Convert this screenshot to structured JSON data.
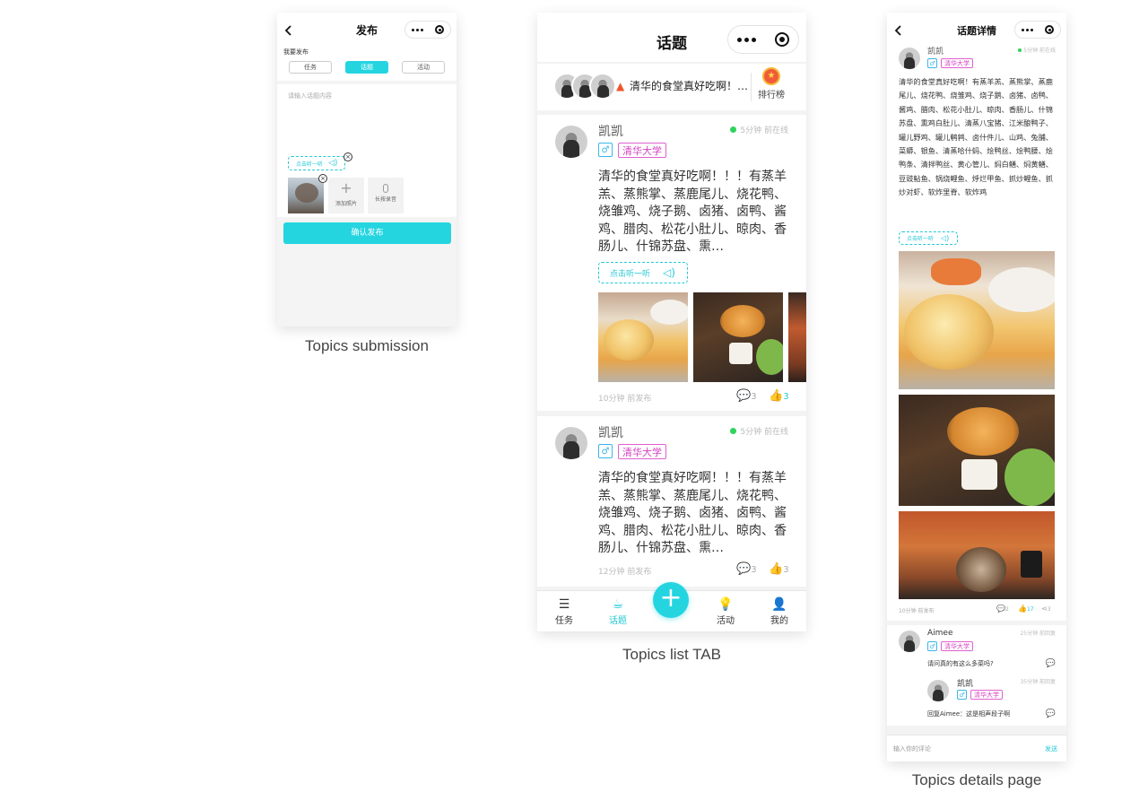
{
  "captions": {
    "submission": "Topics submission",
    "list": "Topics list TAB",
    "details": "Topics details page"
  },
  "submission": {
    "title": "发布",
    "want_label": "我要发布",
    "types": [
      "任务",
      "话题",
      "活动"
    ],
    "active_type": "话题",
    "placeholder": "请输入话题内容",
    "audio_label": "点击听一听",
    "add_photo_label": "添加照片",
    "record_label": "长按录音",
    "submit_label": "确认发布"
  },
  "list": {
    "title": "话题",
    "banner_text": "清华的食堂真好吃啊！…",
    "rank_label": "排行榜",
    "posts": [
      {
        "name": "凯凯",
        "online": "5分钟 前在线",
        "school": "清华大学",
        "gender": "♂",
        "content": "清华的食堂真好吃啊！！！有蒸羊羔、蒸熊掌、蒸鹿尾儿、烧花鸭、烧雏鸡、烧子鹅、卤猪、卤鸭、酱鸡、腊肉、松花小肚儿、晾肉、香肠儿、什锦苏盘、熏…",
        "audio": "点击听一听",
        "time": "10分钟 前发布",
        "comments": "3",
        "likes": "3"
      },
      {
        "name": "凯凯",
        "online": "5分钟 前在线",
        "school": "清华大学",
        "gender": "♂",
        "content": "清华的食堂真好吃啊！！！有蒸羊羔、蒸熊掌、蒸鹿尾儿、烧花鸭、烧雏鸡、烧子鹅、卤猪、卤鸭、酱鸡、腊肉、松花小肚儿、晾肉、香肠儿、什锦苏盘、熏…",
        "time": "12分钟 前发布",
        "comments": "3",
        "likes": "3"
      }
    ],
    "tabs": [
      "任务",
      "话题",
      "活动",
      "我的"
    ],
    "active_tab": "话题"
  },
  "details": {
    "title": "话题详情",
    "author": "凯凯",
    "online": "5分钟 前在线",
    "school": "清华大学",
    "gender": "♂",
    "content": "清华的食堂真好吃啊！有蒸羊羔、蒸熊掌、蒸鹿尾儿、烧花鸭、烧雏鸡、烧子鹅、卤猪、卤鸭、酱鸡、腊肉、松花小肚儿、晾肉、香肠儿、什锦苏盘、熏鸡白肚儿、清蒸八宝猪、江米酿鸭子、罐儿野鸡、罐儿鹌鹑、卤什件儿、山鸡、兔脯、菜蟒、银鱼、清蒸哈什蚂、烩鸭丝、烩鸭腰、烩鸭条、清拌鸭丝、黄心管儿、焖白鳝、焖黄鳝、豆豉鲇鱼、锅烧鲤鱼、烀烂甲鱼、抓炒鲤鱼、抓炒对虾、软炸里脊、软炸鸡",
    "audio": "点击听一听",
    "time": "10分钟 前发布",
    "comments": "2",
    "likes": "17",
    "shares": "3",
    "replies": [
      {
        "name": "Aimee",
        "school": "清华大学",
        "gender": "♂",
        "time": "25分钟 前回复",
        "text": "请问真的有这么多菜吗?"
      },
      {
        "name": "凯凯",
        "school": "清华大学",
        "gender": "♂",
        "time": "35分钟 前回复",
        "text": "回复Aimee：这是相声段子啊"
      }
    ],
    "comment_placeholder": "输入你的评论",
    "send_label": "发送"
  },
  "colors": {
    "accent": "#24d5e0",
    "school": "#d53fc0",
    "gender": "#3ab6e8",
    "online": "#2fd35d"
  }
}
